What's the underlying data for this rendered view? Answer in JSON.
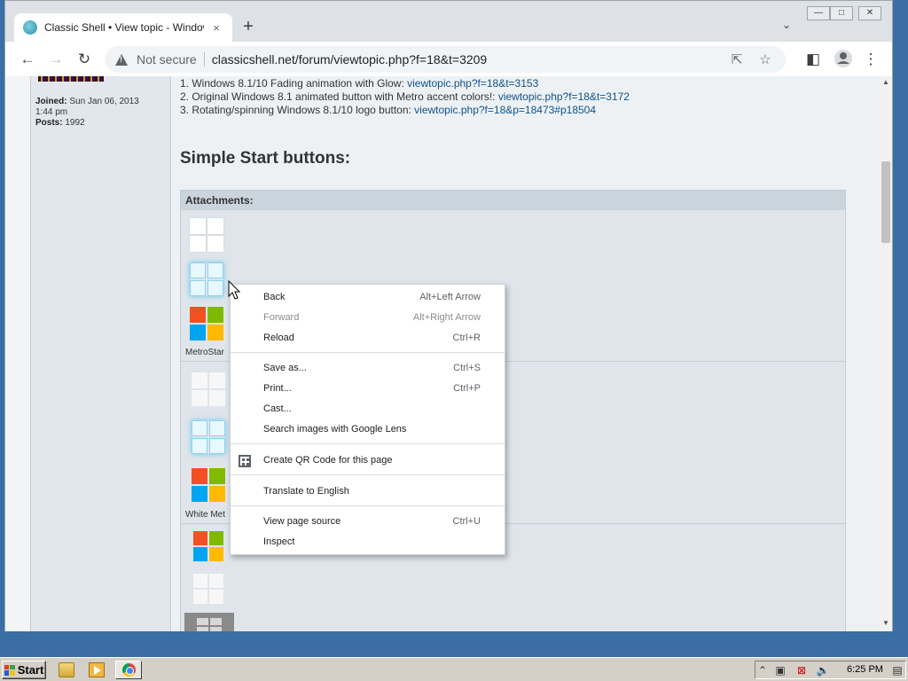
{
  "browser": {
    "tab_title": "Classic Shell • View topic - Windows",
    "tab_close": "×",
    "new_tab": "+",
    "tab_search": "⌄",
    "security_label": "Not secure",
    "url": "classicshell.net/forum/viewtopic.php?f=18&t=3209",
    "window_buttons": {
      "minimize": "—",
      "maximize": "□",
      "close": "✕"
    }
  },
  "profile": {
    "joined_label": "Joined:",
    "joined_value": "Sun Jan 06, 2013",
    "joined_time": "1:44 pm",
    "posts_label": "Posts:",
    "posts_value": "1992"
  },
  "post": {
    "lines": [
      {
        "text": "1. Windows 8.1/10 Fading animation with Glow: ",
        "link": "viewtopic.php?f=18&t=3153"
      },
      {
        "text": "2. Original Windows 8.1 animated button with Metro accent colors!: ",
        "link": "viewtopic.php?f=18&t=3172"
      },
      {
        "text": "3. Rotating/spinning Windows 8.1/10 logo button: ",
        "link": "viewtopic.php?f=18&p=18473#p18504"
      }
    ],
    "section_title": "Simple Start buttons:",
    "attachments_header": "Attachments:",
    "captions": [
      "MetroStar",
      "White Met"
    ]
  },
  "context_menu": {
    "items": [
      {
        "label": "Back",
        "shortcut": "Alt+Left Arrow",
        "disabled": false
      },
      {
        "label": "Forward",
        "shortcut": "Alt+Right Arrow",
        "disabled": true
      },
      {
        "label": "Reload",
        "shortcut": "Ctrl+R",
        "disabled": false
      },
      {
        "label": "Save as...",
        "shortcut": "Ctrl+S",
        "disabled": false
      },
      {
        "label": "Print...",
        "shortcut": "Ctrl+P",
        "disabled": false
      },
      {
        "label": "Cast...",
        "shortcut": "",
        "disabled": false
      },
      {
        "label": "Search images with Google Lens",
        "shortcut": "",
        "disabled": false
      },
      {
        "label": "Create QR Code for this page",
        "shortcut": "",
        "disabled": false,
        "icon": "qr-code-icon"
      },
      {
        "label": "Translate to English",
        "shortcut": "",
        "disabled": false
      },
      {
        "label": "View page source",
        "shortcut": "Ctrl+U",
        "disabled": false
      },
      {
        "label": "Inspect",
        "shortcut": "",
        "disabled": false
      }
    ]
  },
  "taskbar": {
    "start_label": "Start",
    "clock": "6:25 PM"
  },
  "colors": {
    "desktop": "#3a6ea5",
    "link": "#105289",
    "taskbar": "#d4d0c8"
  }
}
